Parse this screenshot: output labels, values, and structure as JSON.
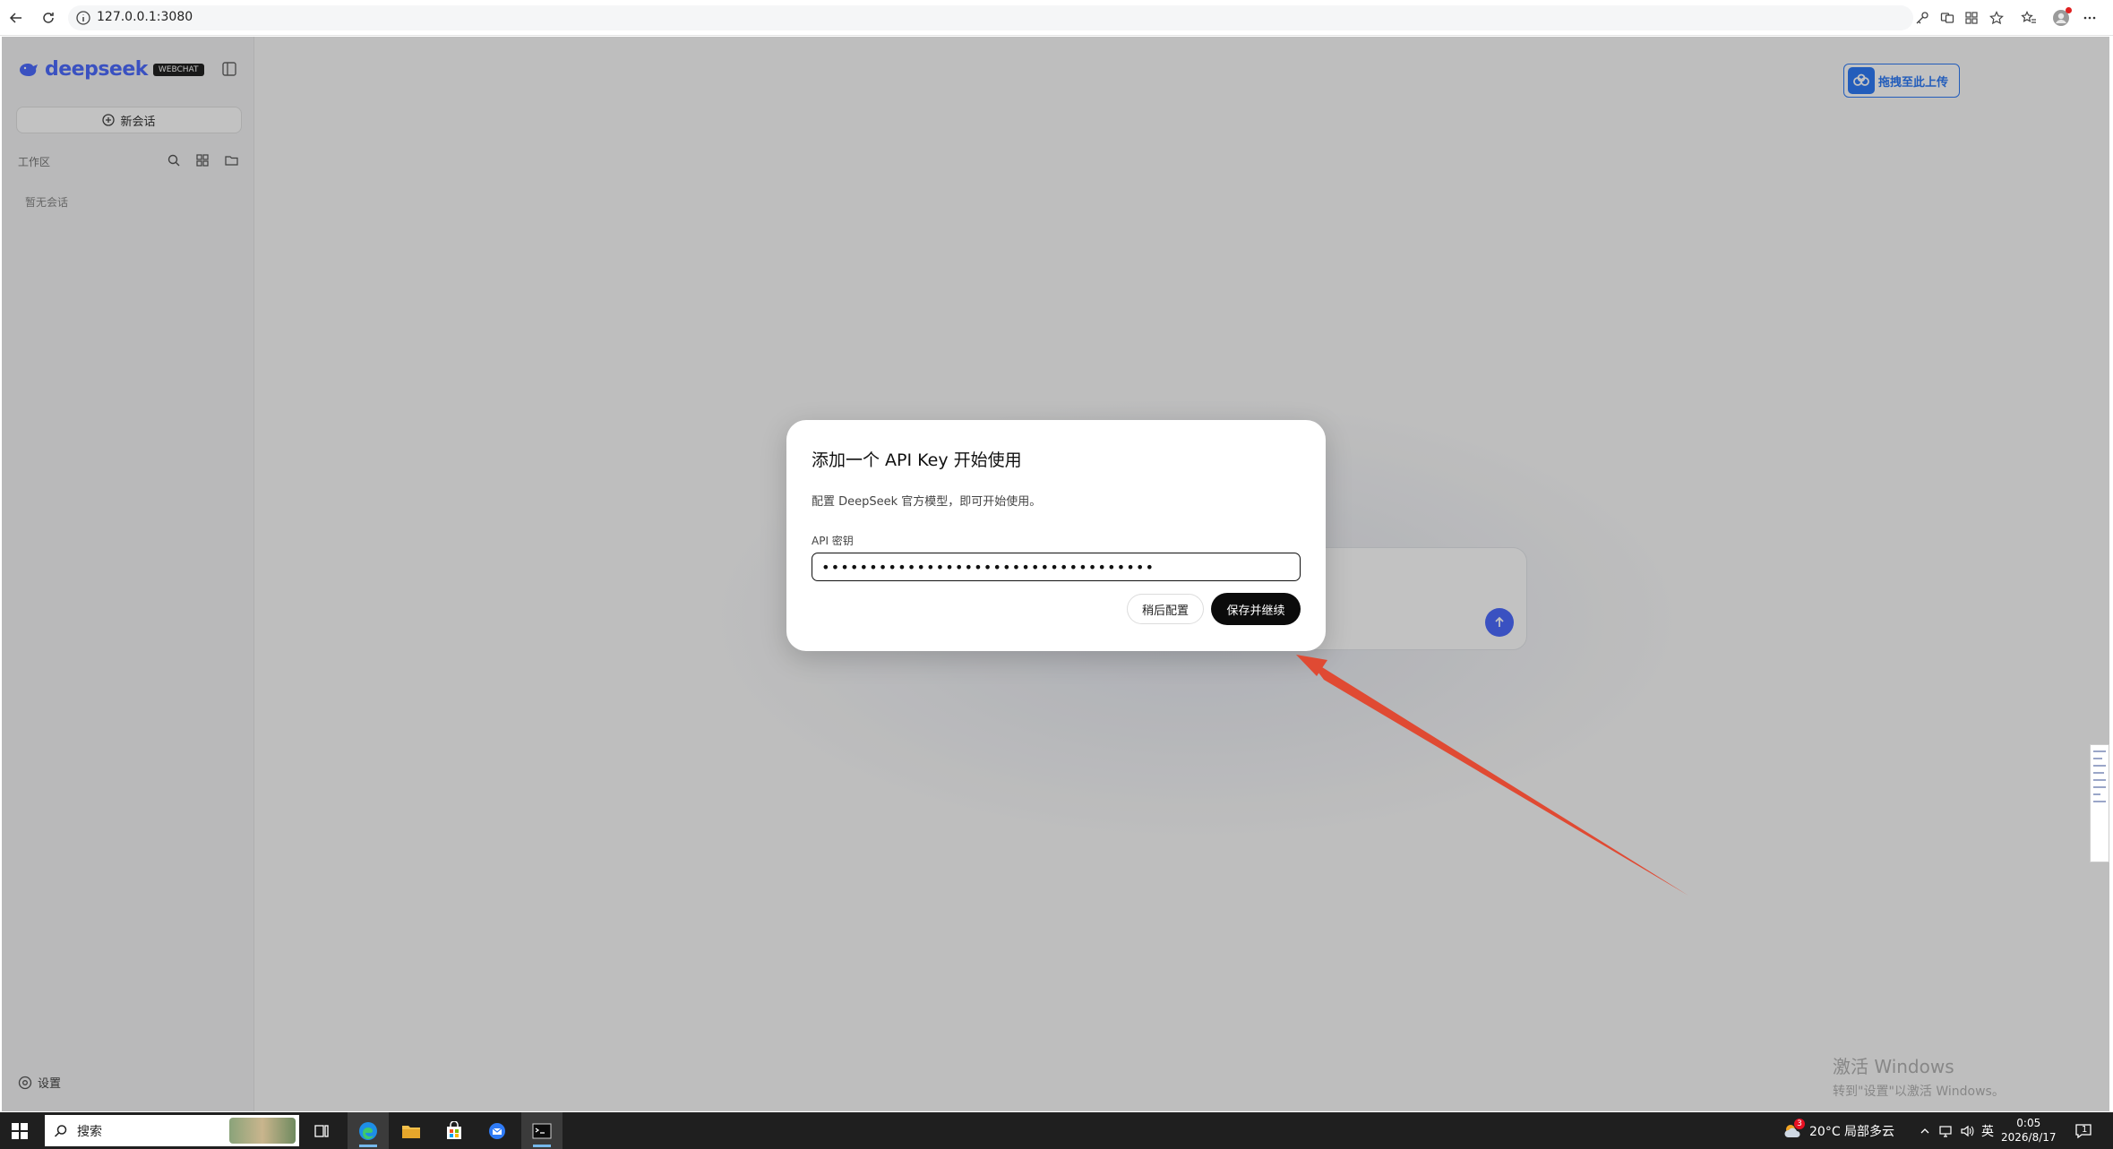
{
  "browser": {
    "url": "127.0.0.1:3080"
  },
  "sidebar": {
    "logo": "deepseek",
    "badge": "WEBCHAT",
    "new_chat": "新会话",
    "workspace_label": "工作区",
    "no_conversations": "暂无会话",
    "settings": "设置"
  },
  "upload_tag": {
    "label": "拖拽至此上传"
  },
  "modal": {
    "title": "添加一个 API Key 开始使用",
    "description": "配置 DeepSeek 官方模型，即可开始使用。",
    "field_label": "API 密钥",
    "key_value": "•••••••••••••••••••••••••••••••••••",
    "later_button": "稍后配置",
    "save_button": "保存并继续"
  },
  "watermark": {
    "line1": "激活 Windows",
    "line2": "转到\"设置\"以激活 Windows。"
  },
  "taskbar": {
    "search": "搜索",
    "weather_badge": "3",
    "weather": "20°C 局部多云",
    "ime": "英",
    "time": "0:05",
    "date": "2026/8/17",
    "notification_count": "1"
  },
  "colors": {
    "brand": "#4d6bfe",
    "upload_blue": "#2f7bf6",
    "arrow": "#e04a33",
    "primary_button": "#0b0b0b"
  }
}
